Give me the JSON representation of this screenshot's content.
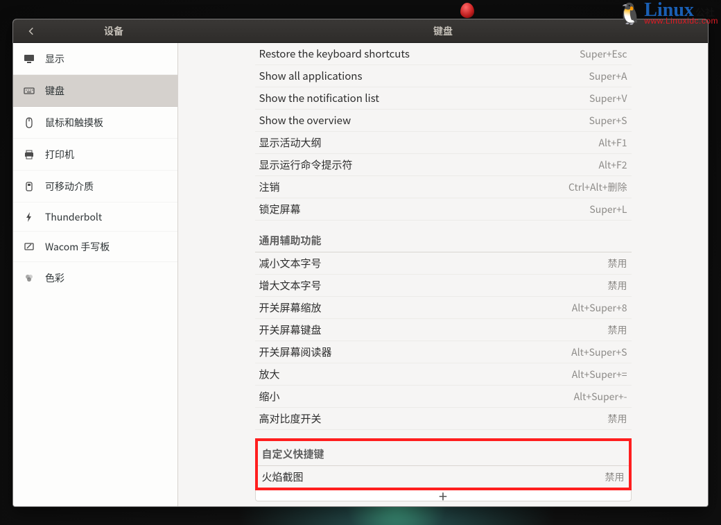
{
  "header": {
    "left_title": "设备",
    "right_title": "键盘"
  },
  "sidebar": {
    "items": [
      {
        "label": "显示",
        "icon": "display"
      },
      {
        "label": "键盘",
        "icon": "keyboard"
      },
      {
        "label": "鼠标和触摸板",
        "icon": "mouse"
      },
      {
        "label": "打印机",
        "icon": "printer"
      },
      {
        "label": "可移动介质",
        "icon": "media"
      },
      {
        "label": "Thunderbolt",
        "icon": "thunderbolt"
      },
      {
        "label": "Wacom 手写板",
        "icon": "tablet"
      },
      {
        "label": "色彩",
        "icon": "color"
      }
    ]
  },
  "sections": [
    {
      "id": "system",
      "rows": [
        {
          "label": "Restore the keyboard shortcuts",
          "value": "Super+Esc"
        },
        {
          "label": "Show all applications",
          "value": "Super+A"
        },
        {
          "label": "Show the notification list",
          "value": "Super+V"
        },
        {
          "label": "Show the overview",
          "value": "Super+S"
        },
        {
          "label": "显示活动大纲",
          "value": "Alt+F1"
        },
        {
          "label": "显示运行命令提示符",
          "value": "Alt+F2"
        },
        {
          "label": "注销",
          "value": "Ctrl+Alt+删除"
        },
        {
          "label": "锁定屏幕",
          "value": "Super+L"
        }
      ]
    },
    {
      "id": "a11y",
      "title": "通用辅助功能",
      "rows": [
        {
          "label": "减小文本字号",
          "value": "禁用"
        },
        {
          "label": "增大文本字号",
          "value": "禁用"
        },
        {
          "label": "开关屏幕缩放",
          "value": "Alt+Super+8"
        },
        {
          "label": "开关屏幕键盘",
          "value": "禁用"
        },
        {
          "label": "开关屏幕阅读器",
          "value": "Alt+Super+S"
        },
        {
          "label": "放大",
          "value": "Alt+Super+="
        },
        {
          "label": "缩小",
          "value": "Alt+Super+-"
        },
        {
          "label": "高对比度开关",
          "value": "禁用"
        }
      ]
    },
    {
      "id": "custom",
      "title": "自定义快捷键",
      "rows": [
        {
          "label": "火焰截图",
          "value": "禁用"
        }
      ]
    }
  ],
  "watermark": {
    "brand": "Linux",
    "suffix": "公社",
    "url": "www.Linuxidc.com"
  },
  "add_label": "+"
}
